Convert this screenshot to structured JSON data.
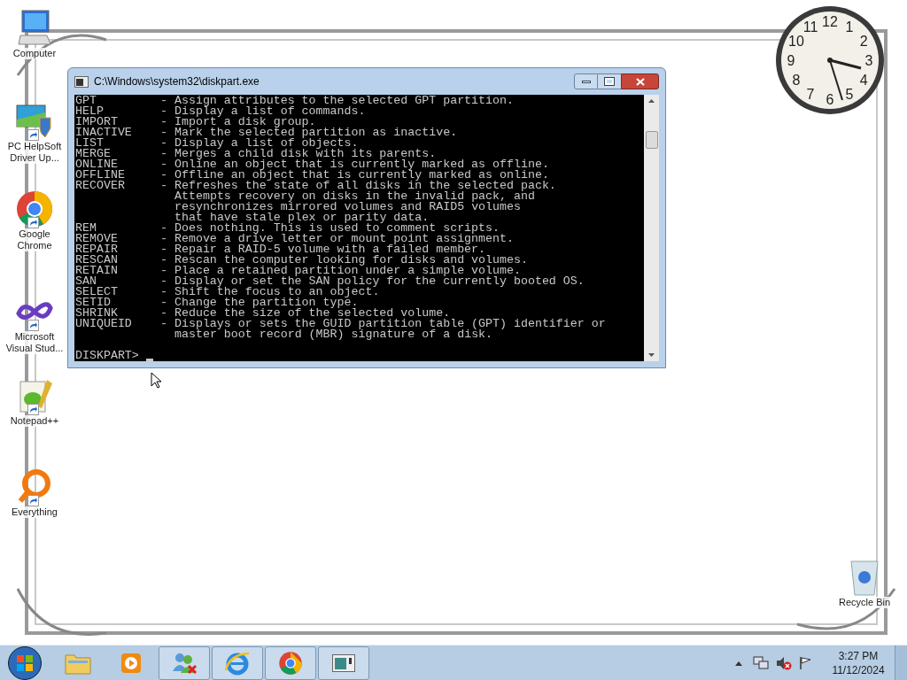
{
  "desktop": {
    "icons": [
      {
        "kind": "computer",
        "label": "Computer",
        "shortcut": false
      },
      {
        "kind": "driver",
        "label": "PC HelpSoft Driver Up...",
        "shortcut": true
      },
      {
        "kind": "chrome",
        "label": "Google Chrome",
        "shortcut": true
      },
      {
        "kind": "studio",
        "label": "Microsoft Visual Stud...",
        "shortcut": true
      },
      {
        "kind": "notepad",
        "label": "Notepad++",
        "shortcut": true
      },
      {
        "kind": "everything",
        "label": "Everything",
        "shortcut": true
      }
    ],
    "recycle_bin": {
      "label": "Recycle Bin"
    }
  },
  "clock": {
    "numerals": [
      "12",
      "11",
      "1",
      "10",
      "2",
      "9",
      "3",
      "8",
      "4",
      "7",
      "5",
      "6"
    ]
  },
  "console_window": {
    "title": "C:\\Windows\\system32\\diskpart.exe",
    "entries": [
      {
        "command": "GPT",
        "description": [
          "- Assign attributes to the selected GPT partition."
        ]
      },
      {
        "command": "HELP",
        "description": [
          "- Display a list of commands."
        ]
      },
      {
        "command": "IMPORT",
        "description": [
          "- Import a disk group."
        ]
      },
      {
        "command": "INACTIVE",
        "description": [
          "- Mark the selected partition as inactive."
        ]
      },
      {
        "command": "LIST",
        "description": [
          "- Display a list of objects."
        ]
      },
      {
        "command": "MERGE",
        "description": [
          "- Merges a child disk with its parents."
        ]
      },
      {
        "command": "ONLINE",
        "description": [
          "- Online an object that is currently marked as offline."
        ]
      },
      {
        "command": "OFFLINE",
        "description": [
          "- Offline an object that is currently marked as online."
        ]
      },
      {
        "command": "RECOVER",
        "description": [
          "- Refreshes the state of all disks in the selected pack.",
          "Attempts recovery on disks in the invalid pack, and",
          "resynchronizes mirrored volumes and RAID5 volumes",
          "that have stale plex or parity data."
        ]
      },
      {
        "command": "REM",
        "description": [
          "- Does nothing. This is used to comment scripts."
        ]
      },
      {
        "command": "REMOVE",
        "description": [
          "- Remove a drive letter or mount point assignment."
        ]
      },
      {
        "command": "REPAIR",
        "description": [
          "- Repair a RAID-5 volume with a failed member."
        ]
      },
      {
        "command": "RESCAN",
        "description": [
          "- Rescan the computer looking for disks and volumes."
        ]
      },
      {
        "command": "RETAIN",
        "description": [
          "- Place a retained partition under a simple volume."
        ]
      },
      {
        "command": "SAN",
        "description": [
          "- Display or set the SAN policy for the currently booted OS."
        ]
      },
      {
        "command": "SELECT",
        "description": [
          "- Shift the focus to an object."
        ]
      },
      {
        "command": "SETID",
        "description": [
          "- Change the partition type."
        ]
      },
      {
        "command": "SHRINK",
        "description": [
          "- Reduce the size of the selected volume."
        ]
      },
      {
        "command": "UNIQUEID",
        "description": [
          "- Displays or sets the GUID partition table (GPT) identifier or",
          "master boot record (MBR) signature of a disk."
        ]
      }
    ],
    "prompt": "DISKPART>"
  },
  "taskbar": {
    "items": [
      {
        "kind": "folder",
        "running": false
      },
      {
        "kind": "media",
        "running": false
      },
      {
        "kind": "people",
        "running": true
      },
      {
        "kind": "ie",
        "running": true
      },
      {
        "kind": "chrome",
        "running": true
      },
      {
        "kind": "console",
        "running": true
      }
    ],
    "tray": {
      "time": "3:27 PM",
      "date": "11/12/2024"
    }
  }
}
